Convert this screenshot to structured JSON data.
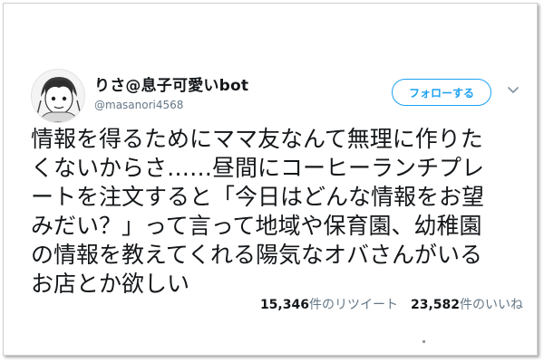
{
  "user": {
    "display_name": "りさ@息子可愛いbot",
    "handle": "@masanori4568",
    "avatar_icon": "avatar-illustration-icon"
  },
  "follow_button": {
    "label": "フォローする"
  },
  "menu_icon": "chevron-down-icon",
  "tweet": {
    "lines": [
      "情報を得るためにママ友なんて無理に作りた",
      "くないからさ……昼間にコーヒーランチプレ",
      "ートを注文すると「今日はどんな情報をお望",
      "みだい？」って言って地域や保育園、幼稚園",
      "の情報を教えてくれる陽気なオバさんがいる",
      "お店とか欲しい"
    ]
  },
  "stats": {
    "retweets": "15,346",
    "retweets_label": "件のリツイート",
    "likes": "23,582",
    "likes_label": "件のいいね"
  },
  "colors": {
    "accent": "#1da1f2",
    "text": "#14171a",
    "muted": "#657786"
  }
}
